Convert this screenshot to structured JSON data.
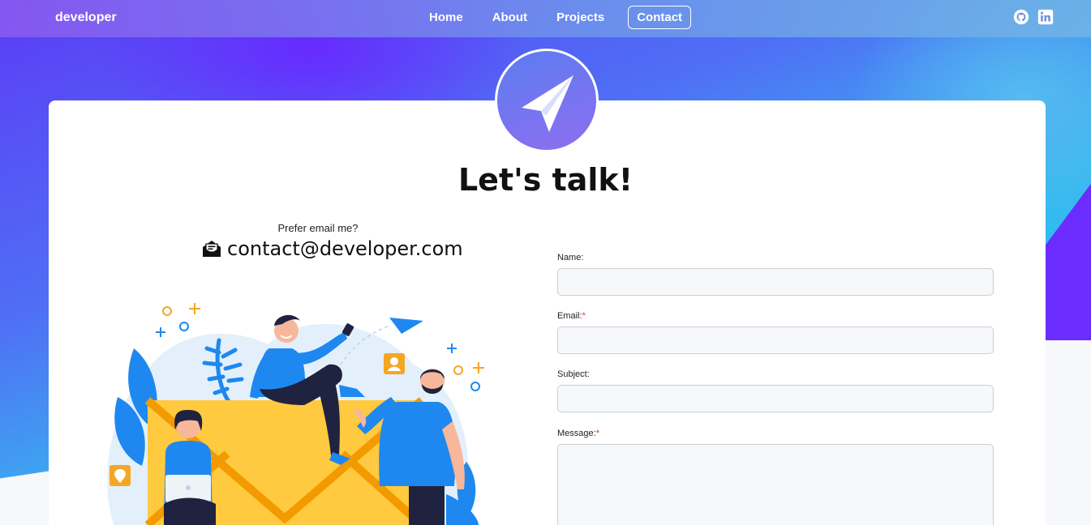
{
  "nav": {
    "brand": "developer",
    "links": [
      {
        "label": "Home"
      },
      {
        "label": "About"
      },
      {
        "label": "Projects"
      },
      {
        "label": "Contact",
        "active": true
      }
    ],
    "social": [
      {
        "icon": "github-icon"
      },
      {
        "icon": "linkedin-icon"
      }
    ]
  },
  "hero": {
    "badge_icon": "paper-plane-icon",
    "title": "Let's talk!"
  },
  "email_section": {
    "prefer": "Prefer email me?",
    "icon": "envelope-open-icon",
    "email": "contact@developer.com"
  },
  "form": {
    "name_label": "Name:",
    "email_label": "Email:",
    "subject_label": "Subject:",
    "message_label": "Message:",
    "required_mark": "*",
    "name_value": "",
    "email_value": "",
    "subject_value": "",
    "message_value": ""
  },
  "colors": {
    "accent_purple": "#6a2cff",
    "accent_cyan": "#0dd0ee",
    "illustration_blue": "#1e88f0",
    "illustration_yellow": "#ffc940"
  }
}
